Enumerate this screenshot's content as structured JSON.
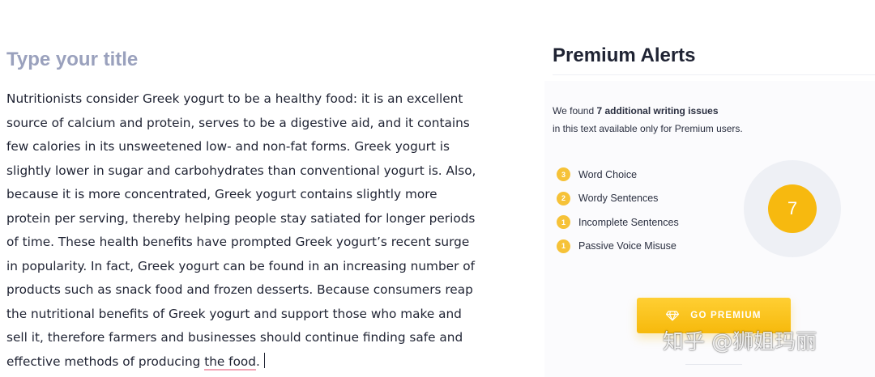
{
  "editor": {
    "title_placeholder": "Type your title",
    "lines": [
      "Nutritionists consider Greek yogurt to be a healthy food: it is an excellent",
      "source of calcium and protein, serves to be a digestive aid, and it contains",
      "few calories in its unsweetened low- and non-fat forms. Greek yogurt is",
      "slightly lower in sugar and carbohydrates than conventional yogurt is. Also,",
      "because it is more concentrated, Greek yogurt contains slightly more",
      "protein per serving, thereby helping people stay satiated for longer periods",
      "of time. These health benefits have prompted Greek yogurt’s recent surge",
      "in popularity. In fact, Greek yogurt can be found in an increasing number of",
      "products such as snack food and frozen desserts. Because consumers reap",
      "the nutritional benefits of Greek yogurt and support those who make and",
      "sell it, therefore farmers and businesses should continue finding safe and"
    ],
    "last_line_prefix": "effective methods of producing ",
    "last_line_flagged": "the food",
    "last_line_suffix": "."
  },
  "panel": {
    "header": "Premium Alerts",
    "found_prefix": "We found ",
    "found_count_text": "7 additional writing issues",
    "found_suffix": "in this text available only for Premium users.",
    "issues": [
      {
        "count": "3",
        "label": "Word Choice"
      },
      {
        "count": "2",
        "label": "Wordy Sentences"
      },
      {
        "count": "1",
        "label": "Incomplete Sentences"
      },
      {
        "count": "1",
        "label": "Passive Voice Misuse"
      }
    ],
    "total": "7",
    "button_label": "GO PREMIUM",
    "button_icon": "diamond-icon"
  },
  "watermark": "知乎 @狮姐玛丽",
  "colors": {
    "accent": "#f6b90c",
    "title_placeholder": "#9aa1bd",
    "text": "#1f2333",
    "flag_underline": "#f2a5b6"
  }
}
